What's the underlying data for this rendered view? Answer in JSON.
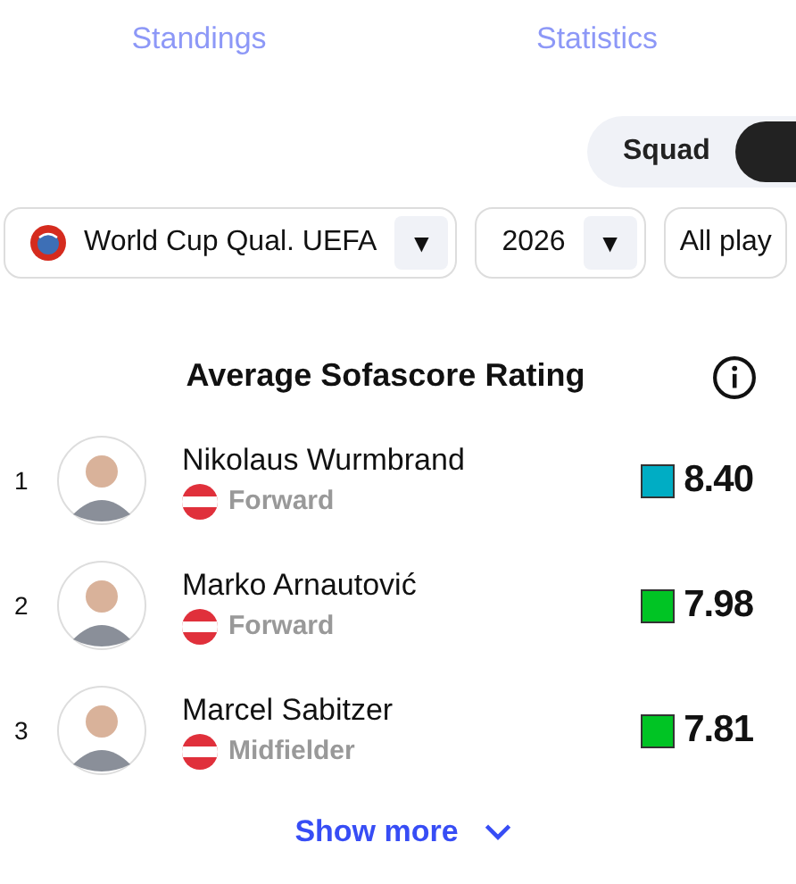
{
  "tabs": [
    {
      "label": "Standings",
      "selected": false
    },
    {
      "label": "Statistics",
      "selected": false
    }
  ],
  "view_toggle": [
    {
      "label": "Squad",
      "selected": false
    },
    {
      "selected": true
    }
  ],
  "filters": [
    {
      "kind": "competition",
      "value": "World Cup Qual. UEFA",
      "arrow": "▼"
    },
    {
      "kind": "plain",
      "value": "2026",
      "arrow": "▼"
    },
    {
      "kind": "plain",
      "value": "All play"
    }
  ],
  "ranking": {
    "title": "Average Sofascore Rating",
    "players": [
      {
        "rank": "1",
        "name": "Nikolaus Wurmbrand",
        "position": "Forward",
        "rating": "8.40",
        "color": "#00adc4"
      },
      {
        "rank": "2",
        "name": "Marko Arnautović",
        "position": "Forward",
        "rating": "7.98",
        "color": "#00c424"
      },
      {
        "rank": "3",
        "name": "Marcel Sabitzer",
        "position": "Midfielder",
        "rating": "7.81",
        "color": "#00c424"
      }
    ],
    "show_more": "Show more"
  }
}
